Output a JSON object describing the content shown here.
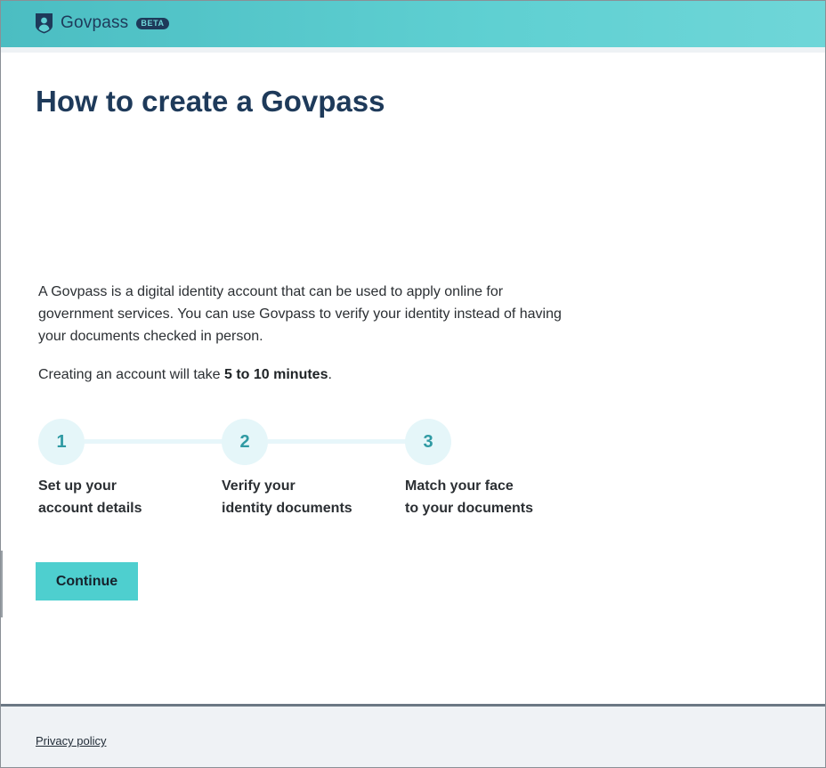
{
  "header": {
    "brand_name": "Govpass",
    "beta_label": "BETA",
    "logo_icon": "shield-person-icon",
    "accent_color": "#5fd0d2"
  },
  "main": {
    "title": "How to create a Govpass",
    "intro": "A Govpass is a digital identity account that can be used to apply online for government services. You can use Govpass to verify your identity instead of having your documents checked in person.",
    "duration_prefix": "Creating an account will take ",
    "duration_value": "5 to 10 minutes",
    "duration_suffix": ".",
    "steps": [
      {
        "number": "1",
        "label_line1": "Set up your",
        "label_line2": "account details"
      },
      {
        "number": "2",
        "label_line1": "Verify your",
        "label_line2": "identity documents"
      },
      {
        "number": "3",
        "label_line1": "Match your face",
        "label_line2": "to your documents"
      }
    ],
    "continue_label": "Continue",
    "button_color": "#4ecfcf"
  },
  "footer": {
    "privacy_label": "Privacy policy"
  }
}
